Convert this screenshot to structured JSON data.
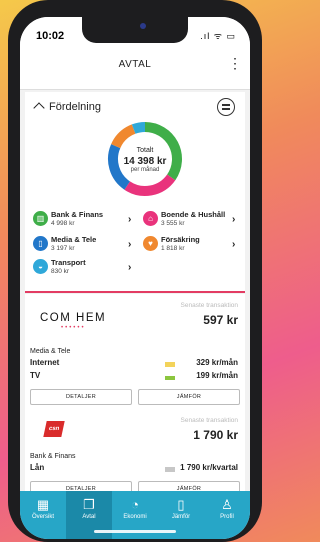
{
  "status": {
    "time": "10:02",
    "icons": ".ıl ᯤ ▭"
  },
  "nav": {
    "title": "AVTAL"
  },
  "distribution": {
    "header": "Fördelning",
    "total_label": "Totalt",
    "total_value": "14 398 kr",
    "total_sub": "per månad",
    "segments": [
      {
        "name": "Bank & Finans",
        "color": "#3fae49",
        "value": 4998
      },
      {
        "name": "Boende & Hushåll",
        "color": "#e9337c",
        "value": 3555
      },
      {
        "name": "Media & Tele",
        "color": "#2277c9",
        "value": 3197
      },
      {
        "name": "Försäkring",
        "color": "#f0882f",
        "value": 1818
      },
      {
        "name": "Transport",
        "color": "#2fa8d9",
        "value": 830
      }
    ],
    "categories": [
      {
        "name": "Bank & Finans",
        "amount": "4 998 kr",
        "icon": "bar-chart-icon",
        "color": "#3fae49",
        "glyph": "▥"
      },
      {
        "name": "Boende & Hushåll",
        "amount": "3 555 kr",
        "icon": "house-icon",
        "color": "#e9337c",
        "glyph": "⌂"
      },
      {
        "name": "Media & Tele",
        "amount": "3 197 kr",
        "icon": "phone-icon",
        "color": "#2277c9",
        "glyph": "▯"
      },
      {
        "name": "Försäkring",
        "amount": "1 818 kr",
        "icon": "heart-icon",
        "color": "#f0882f",
        "glyph": "♥"
      },
      {
        "name": "Transport",
        "amount": "830 kr",
        "icon": "car-icon",
        "color": "#2fa8d9",
        "glyph": "◒"
      }
    ]
  },
  "transactions": [
    {
      "brand": "COM HEM",
      "latest_label": "Senaste transaktion",
      "amount": "597 kr",
      "category": "Media & Tele",
      "rows": [
        {
          "name": "Internet",
          "value": "329 kr/mån"
        },
        {
          "name": "TV",
          "value": "199 kr/mån"
        }
      ],
      "details_label": "DETALJER",
      "compare_label": "JÄMFÖR"
    },
    {
      "brand": "csn",
      "latest_label": "Senaste transaktion",
      "amount": "1 790 kr",
      "category": "Bank & Finans",
      "rows": [
        {
          "name": "Lån",
          "value": "1 790 kr/kvartal"
        }
      ],
      "details_label": "DETALJER",
      "compare_label": "JÄMFÖR"
    }
  ],
  "tabbar": [
    {
      "label": "Översikt",
      "icon": "grid-icon",
      "glyph": "▦",
      "active": false
    },
    {
      "label": "Avtal",
      "icon": "documents-icon",
      "glyph": "❐",
      "active": true
    },
    {
      "label": "Ekonomi",
      "icon": "pie-icon",
      "glyph": "◔",
      "active": false
    },
    {
      "label": "Jämför",
      "icon": "bars-icon",
      "glyph": "▯",
      "active": false
    },
    {
      "label": "Profil",
      "icon": "person-icon",
      "glyph": "♙",
      "active": false
    }
  ]
}
